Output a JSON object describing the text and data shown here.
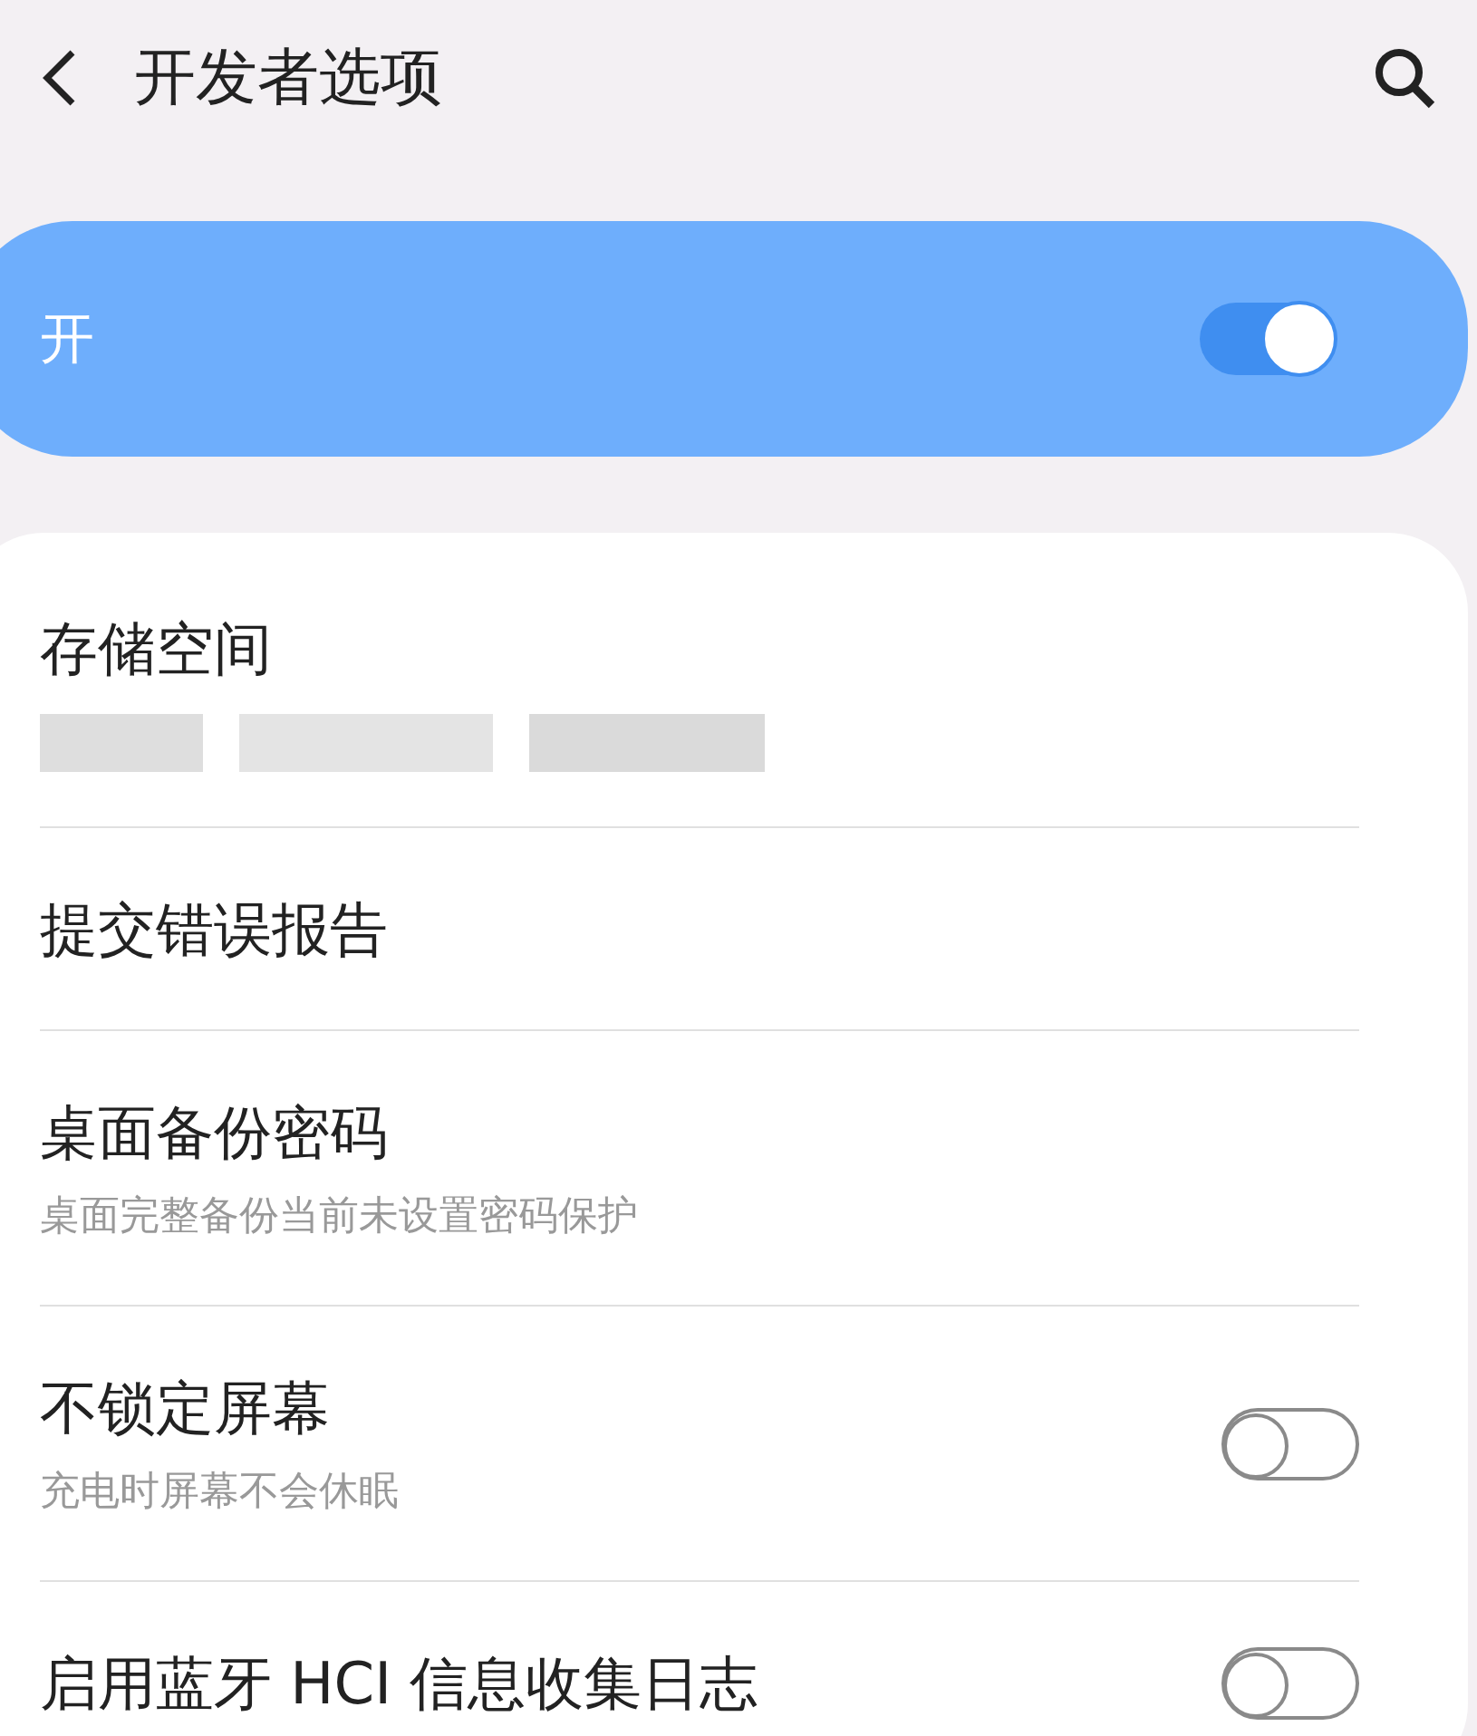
{
  "header": {
    "title": "开发者选项"
  },
  "master": {
    "label": "开",
    "on": true
  },
  "items": [
    {
      "kind": "redacted",
      "title": "存储空间"
    },
    {
      "kind": "plain",
      "title": "提交错误报告"
    },
    {
      "kind": "plain",
      "title": "桌面备份密码",
      "subtitle": "桌面完整备份当前未设置密码保护"
    },
    {
      "kind": "switch",
      "title": "不锁定屏幕",
      "subtitle": "充电时屏幕不会休眠",
      "on": false
    },
    {
      "kind": "switch",
      "title": "启用蓝牙 HCI 信息收集日志",
      "on": false
    }
  ]
}
